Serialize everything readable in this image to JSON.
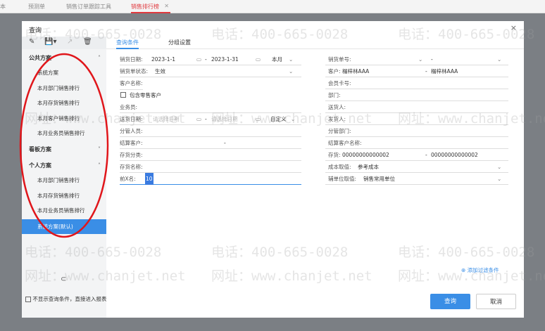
{
  "top_tabs": [
    {
      "label": "本"
    },
    {
      "label": "预测单"
    },
    {
      "label": "销售订单跟踪工具"
    },
    {
      "label": "销售排行榜",
      "active": true
    }
  ],
  "dialog": {
    "title": "查询",
    "close": "×"
  },
  "sidebar": {
    "tool_icons": [
      "edit-icon",
      "save-icon",
      "export-icon",
      "delete-icon"
    ],
    "public": {
      "label": "公共方案",
      "items": [
        "系统方案",
        "本月部门销售排行",
        "本月存货销售排行",
        "本月客户销售排行",
        "本月业务员销售排行"
      ]
    },
    "board": {
      "label": "看板方案"
    },
    "personal": {
      "label": "个人方案",
      "items": [
        "本月部门销售排行",
        "本月存货销售排行",
        "本月业务员销售排行"
      ]
    },
    "selected": "系统方案(默认)"
  },
  "tabs": [
    {
      "label": "查询条件",
      "active": true
    },
    {
      "label": "分组设置"
    }
  ],
  "left_fields": {
    "sales_date": {
      "label": "销货日期:",
      "from": "2023-1-1",
      "sep": "-",
      "to": "2023-1-31",
      "period": "本月"
    },
    "status": {
      "label": "销货单状态:",
      "value": "生效"
    },
    "customer_name": {
      "label": "客户名称:"
    },
    "include_retail": {
      "label": "包含零售客户",
      "checked": false
    },
    "salesman": {
      "label": "业务员:"
    },
    "delivery_date": {
      "label": "送货日期:",
      "from_placeholder": "请选择日期",
      "sep": "-",
      "to_placeholder": "请选择日期",
      "period": "自定义"
    },
    "manager": {
      "label": "分管人员:"
    },
    "settle_customer": {
      "label": "结算客户:",
      "sep": "-"
    },
    "inv_category": {
      "label": "存货分类:"
    },
    "inv_name": {
      "label": "存货名称:"
    },
    "top_n": {
      "label": "前X名:",
      "value": "10"
    }
  },
  "right_fields": {
    "sales_no": {
      "label": "销货单号:",
      "sep": "-"
    },
    "customer": {
      "label": "客户:",
      "from": "榻梓林AAA",
      "sep": "-",
      "to": "榻梓林AAA"
    },
    "member_card": {
      "label": "会员卡号:"
    },
    "department": {
      "label": "部门:"
    },
    "deliverer": {
      "label": "送货人:"
    },
    "shipper": {
      "label": "发货人:"
    },
    "manage_dept": {
      "label": "分管部门:"
    },
    "settle_customer_name": {
      "label": "结算客户名称:"
    },
    "inventory": {
      "label": "存货:",
      "from": "00000000000002",
      "sep": "-",
      "to": "00000000000002"
    },
    "cost": {
      "label": "成本取值:",
      "value": "参考成本"
    },
    "aux_unit": {
      "label": "辅单位取值:",
      "value": "销售常用单位"
    }
  },
  "add_filter": "添加过滤条件",
  "skip_conditions": {
    "label": "不显示查询条件，直接进入报表",
    "checked": false
  },
  "buttons": {
    "query": "查询",
    "cancel": "取消"
  },
  "watermark": {
    "phone": "电话：400-665-0028",
    "site": "网址：www.chanjet.net"
  },
  "colors": {
    "accent": "#3a8ee6",
    "tab_active": "#e0393e",
    "annotation": "#e0161b"
  }
}
